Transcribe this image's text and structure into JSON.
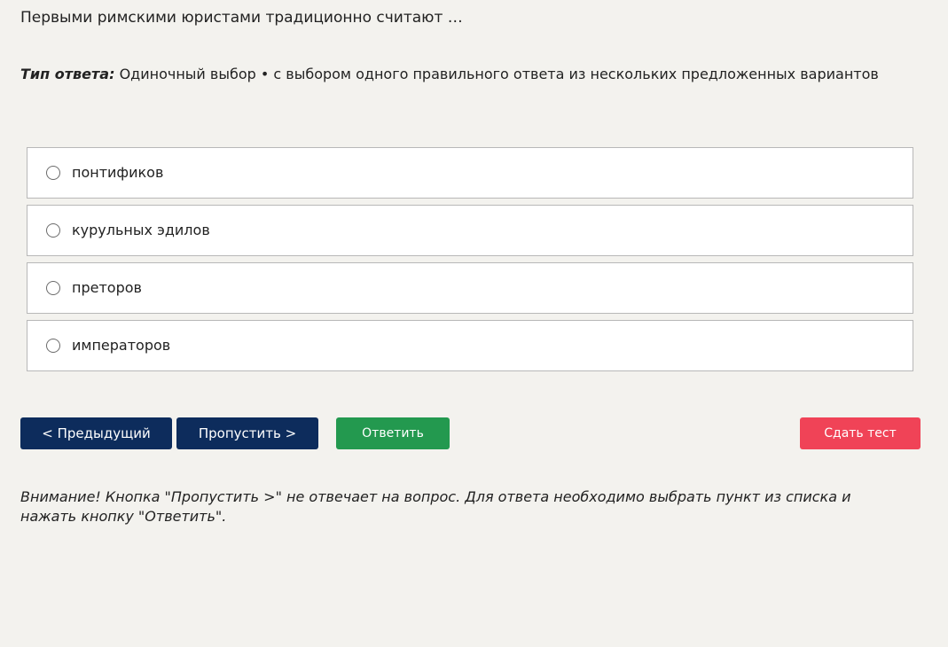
{
  "question": {
    "text": "Первыми римскими юристами традиционно считают …"
  },
  "answer_type": {
    "label": "Тип ответа:",
    "value": "Одиночный выбор • с выбором одного правильного ответа из нескольких предложенных вариантов"
  },
  "options": [
    {
      "label": "понтификов"
    },
    {
      "label": "курульных эдилов"
    },
    {
      "label": "преторов"
    },
    {
      "label": "императоров"
    }
  ],
  "buttons": {
    "prev": "< Предыдущий",
    "skip": "Пропустить >",
    "answer": "Ответить",
    "submit": "Сдать тест"
  },
  "colors": {
    "primary": "#0d2c5c",
    "answer": "#23994f",
    "submit": "#f04357",
    "background": "#f3f2ee"
  },
  "warning": {
    "text": "Внимание! Кнопка \"Пропустить >\" не отвечает на вопрос. Для ответа необходимо выбрать пункт из списка и нажать кнопку \"Ответить\"."
  }
}
